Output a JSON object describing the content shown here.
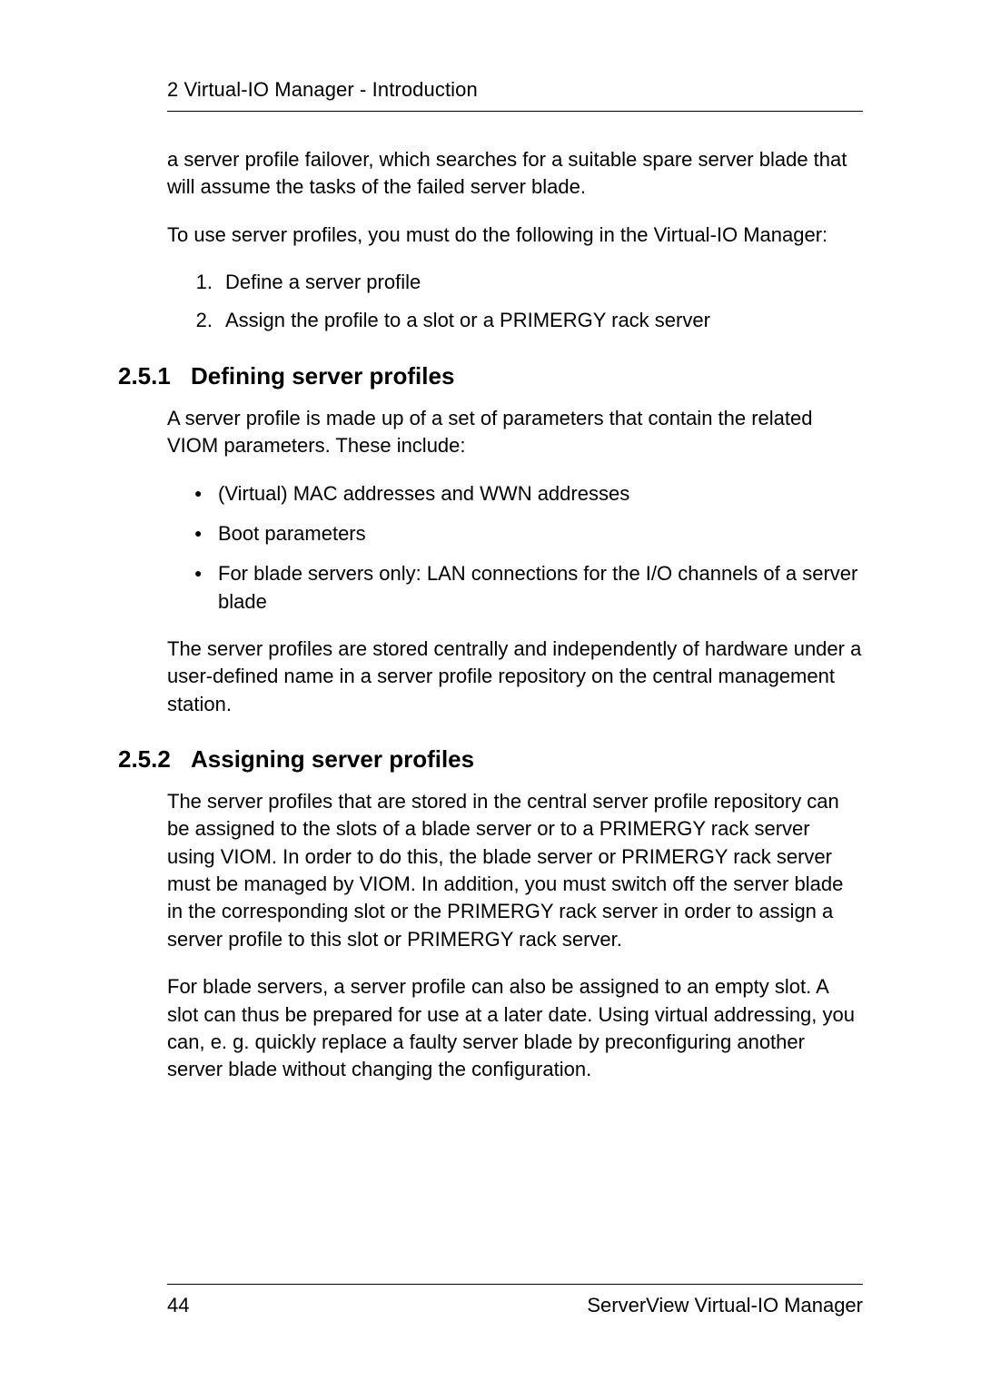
{
  "header": {
    "chapter": "2 Virtual-IO Manager - Introduction"
  },
  "intro": {
    "p1": "a server profile failover, which searches for a suitable spare server blade that will assume the tasks of the failed server blade.",
    "p2": "To use server profiles, you must do the following in the Virtual-IO Manager:",
    "ol": {
      "n1": "1.",
      "t1": "Define a server profile",
      "n2": "2.",
      "t2": "Assign the profile to a slot or a PRIMERGY rack server"
    }
  },
  "s251": {
    "num": "2.5.1",
    "title": "Defining server profiles",
    "p1": "A server profile is made up of a set of parameters that contain the related VIOM parameters. These include:",
    "ul": {
      "b1": "(Virtual) MAC addresses and WWN addresses",
      "b2": "Boot parameters",
      "b3": "For blade servers only: LAN connections for the I/O channels of a server blade"
    },
    "p2": "The server profiles are stored centrally and independently of hardware under a user-defined name in a server profile repository on the central management station."
  },
  "s252": {
    "num": "2.5.2",
    "title": "Assigning server profiles",
    "p1": "The server profiles that are stored in the central server profile repository can be assigned to the slots of a blade server or to a PRIMERGY rack server using VIOM. In order to do this, the blade server or PRIMERGY rack server must be managed by VIOM. In addition, you must switch off the server blade in the corresponding slot or the PRIMERGY rack server in order to assign a server profile to this slot or PRIMERGY rack server.",
    "p2": "For blade servers, a server profile can also be assigned to an empty slot. A slot can thus be prepared for use at a later date. Using virtual addressing, you can, e. g. quickly replace a faulty server blade by preconfiguring another server blade without changing the configuration."
  },
  "footer": {
    "page": "44",
    "doc": "ServerView Virtual-IO Manager"
  }
}
